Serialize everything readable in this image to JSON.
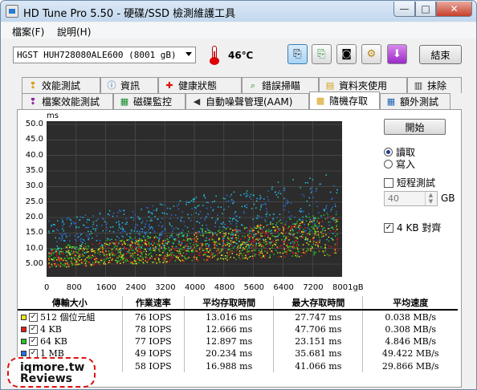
{
  "window": {
    "title": "HD Tune Pro 5.50 - 硬碟/SSD 檢測維護工具",
    "buttons": [
      "—",
      "□",
      "✕"
    ]
  },
  "menu": [
    "檔案(F)",
    "說明(H)"
  ],
  "toolbar": {
    "drive": "HGST HUH728080ALE600 (8001 gB)",
    "temperature": "46℃",
    "exit_label": "結束",
    "icons": [
      "copy-icon",
      "copy-alt-icon",
      "camera-icon",
      "tools-icon",
      "download-icon"
    ]
  },
  "tabs_top": [
    {
      "label": "效能測試",
      "icon": "benchmark-icon",
      "glyph": "❢",
      "color": "#d4a017"
    },
    {
      "label": "資訊",
      "icon": "info-icon",
      "glyph": "i",
      "color": "#1f5fb0"
    },
    {
      "label": "健康狀態",
      "icon": "health-icon",
      "glyph": "✚",
      "color": "#d11"
    },
    {
      "label": "錯誤掃瞄",
      "icon": "error-scan-icon",
      "glyph": "⌕",
      "color": "#118a2a"
    },
    {
      "label": "資料夾使用",
      "icon": "folder-icon",
      "glyph": "▤",
      "color": "#d4a017"
    },
    {
      "label": "抹除",
      "icon": "erase-icon",
      "glyph": "▥",
      "color": "#333"
    }
  ],
  "tabs_bottom": [
    {
      "label": "檔案效能測試",
      "icon": "file-benchmark-icon",
      "glyph": "❢",
      "color": "#8a2aa0",
      "active": false
    },
    {
      "label": "磁碟監控",
      "icon": "monitor-icon",
      "glyph": "▦",
      "color": "#118a2a",
      "active": false
    },
    {
      "label": "自動噪聲管理(AAM)",
      "icon": "speaker-icon",
      "glyph": "◀",
      "color": "#333",
      "active": false
    },
    {
      "label": "隨機存取",
      "icon": "random-access-icon",
      "glyph": "▩",
      "color": "#d4a017",
      "active": true
    },
    {
      "label": "額外測試",
      "icon": "extra-tests-icon",
      "glyph": "▦",
      "color": "#1f5fb0",
      "active": false
    }
  ],
  "side": {
    "start_label": "開始",
    "read_label": "讀取",
    "write_label": "寫入",
    "short_test_label": "短程測試",
    "gb_value": "40",
    "gb_unit": "GB",
    "align_label": "4 KB 對齊"
  },
  "chart_data": {
    "type": "scatter",
    "y_unit": "ms",
    "x_unit": "gB",
    "xlim": [
      0,
      8001
    ],
    "ylim": [
      0,
      50
    ],
    "y_ticks": [
      "50.0",
      "45.0",
      "40.0",
      "35.0",
      "30.0",
      "25.0",
      "20.0",
      "15.0",
      "10.0",
      "5.00"
    ],
    "x_ticks": [
      "0",
      "800",
      "1600",
      "2400",
      "3200",
      "4000",
      "4800",
      "5600",
      "6400",
      "7200",
      "8001gB"
    ],
    "series": [
      {
        "name": "512 個位元組",
        "color": "#f2e41c"
      },
      {
        "name": "4 KB",
        "color": "#e01c1c"
      },
      {
        "name": "64 KB",
        "color": "#22c422"
      },
      {
        "name": "1 MB",
        "color": "#2a6fe0"
      },
      {
        "name": "Random",
        "color": "#22c6d6"
      }
    ]
  },
  "table": {
    "headers": [
      "傳輸大小",
      "作業速率",
      "平均存取時間",
      "最大存取時間",
      "平均速度"
    ],
    "rows": [
      {
        "label": "512 個位元組",
        "color": "#f2e41c",
        "rate": "76 IOPS",
        "avg": "13.016 ms",
        "max": "27.747 ms",
        "speed": "0.038 MB/s"
      },
      {
        "label": "4 KB",
        "color": "#e01c1c",
        "rate": "78 IOPS",
        "avg": "12.666 ms",
        "max": "47.706 ms",
        "speed": "0.308 MB/s"
      },
      {
        "label": "64 KB",
        "color": "#22c422",
        "rate": "77 IOPS",
        "avg": "12.897 ms",
        "max": "23.151 ms",
        "speed": "4.846 MB/s"
      },
      {
        "label": "1 MB",
        "color": "#2a6fe0",
        "rate": "49 IOPS",
        "avg": "20.234 ms",
        "max": "35.681 ms",
        "speed": "49.422 MB/s"
      },
      {
        "label": "隨機",
        "color": "#22c6d6",
        "rate": "58 IOPS",
        "avg": "16.988 ms",
        "max": "41.066 ms",
        "speed": "29.866 MB/s"
      }
    ]
  },
  "watermark": {
    "line1": "iqmore.tw",
    "line2": "Reviews"
  }
}
